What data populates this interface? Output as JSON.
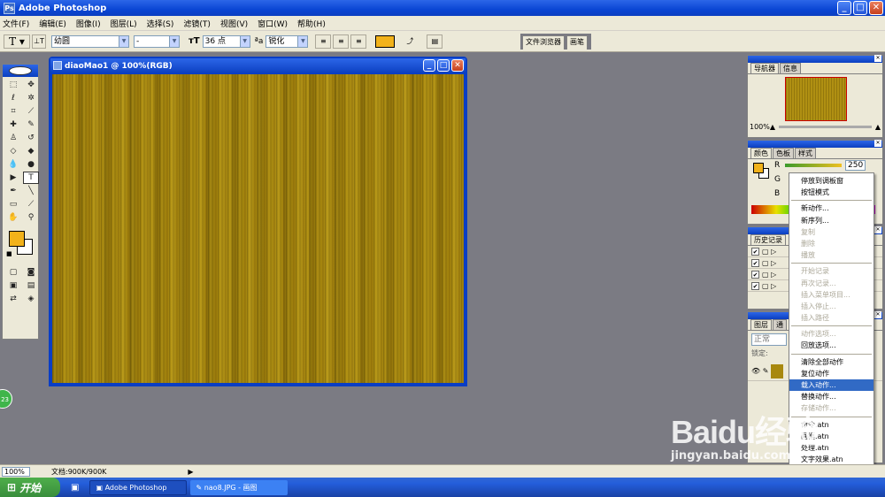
{
  "app": {
    "title": "Adobe Photoshop",
    "icon_label": "Ps"
  },
  "window_buttons": {
    "minimize": "_",
    "maximize": "□",
    "close": "✕"
  },
  "menu": [
    "文件(F)",
    "编辑(E)",
    "图像(I)",
    "图层(L)",
    "选择(S)",
    "滤镜(T)",
    "视图(V)",
    "窗口(W)",
    "帮助(H)"
  ],
  "options": {
    "tool_glyph": "T",
    "font_family": "幼圆",
    "font_style": "-",
    "font_size": "36 点",
    "antialias": "锐化",
    "color_hex": "#f2b21a"
  },
  "palette_well": [
    "文件浏览器",
    "画笔"
  ],
  "document": {
    "title": "diaoMao1 @ 100%(RGB)"
  },
  "navigator": {
    "tabs": [
      "导航器",
      "信息"
    ],
    "zoom": "100%"
  },
  "color_panel": {
    "tabs": [
      "颜色",
      "色板",
      "样式"
    ],
    "channels": [
      "R",
      "G",
      "B"
    ],
    "r_value": "250"
  },
  "history_panel": {
    "tab": "历史记录"
  },
  "layers_panel": {
    "tabs": [
      "图层",
      "通"
    ],
    "blend_mode": "正常",
    "lock_label": "锁定:"
  },
  "context_menu": {
    "groups": [
      [
        {
          "label": "停放到调板窗",
          "enabled": true
        },
        {
          "label": "按钮模式",
          "enabled": true
        }
      ],
      [
        {
          "label": "新动作...",
          "enabled": true
        },
        {
          "label": "新序列...",
          "enabled": true
        },
        {
          "label": "复制",
          "enabled": false
        },
        {
          "label": "删除",
          "enabled": false
        },
        {
          "label": "播放",
          "enabled": false
        }
      ],
      [
        {
          "label": "开始记录",
          "enabled": false
        },
        {
          "label": "再次记录...",
          "enabled": false
        },
        {
          "label": "插入菜单项目...",
          "enabled": false
        },
        {
          "label": "插入停止...",
          "enabled": false
        },
        {
          "label": "插入路径",
          "enabled": false
        }
      ],
      [
        {
          "label": "动作选项...",
          "enabled": false
        },
        {
          "label": "回放选项...",
          "enabled": true
        }
      ],
      [
        {
          "label": "清除全部动作",
          "enabled": true
        },
        {
          "label": "复位动作",
          "enabled": true
        },
        {
          "label": "载入动作...",
          "enabled": true,
          "highlighted": true
        },
        {
          "label": "替换动作...",
          "enabled": true
        },
        {
          "label": "存储动作...",
          "enabled": false
        }
      ],
      [
        {
          "label": "命令.atn",
          "enabled": true
        },
        {
          "label": "画框.atn",
          "enabled": true
        },
        {
          "label": "处理.atn",
          "enabled": true
        },
        {
          "label": "文字效果.atn",
          "enabled": true
        },
        {
          "label": "画框.atn",
          "enabled": true
        },
        {
          "label": "纹理.atn",
          "enabled": true
        }
      ]
    ]
  },
  "status": {
    "zoom": "100%",
    "doc_info": "文档:900K/900K"
  },
  "taskbar": {
    "start": "开始",
    "tasks": [
      "Adobe Photoshop",
      "nao8.JPG - 画图"
    ]
  },
  "watermark": {
    "brand": "Baidu经验",
    "url": "jingyan.baidu.com"
  },
  "badge": "23"
}
